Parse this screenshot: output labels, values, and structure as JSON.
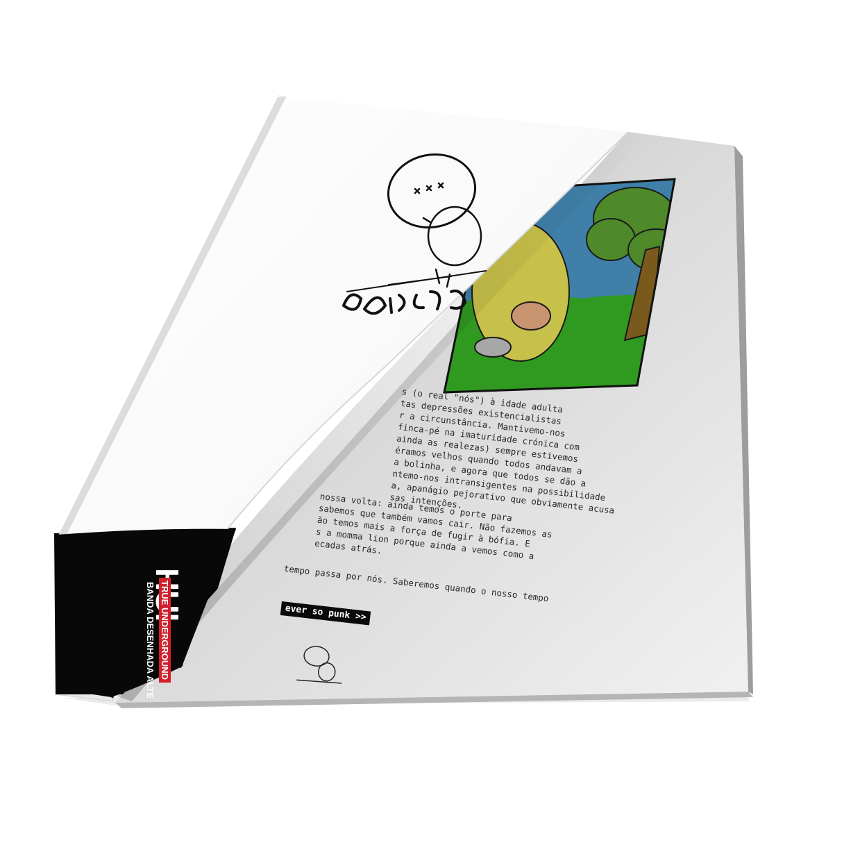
{
  "paragraphs": [
    {
      "lines": [
        "s (o real \"nós\") à idade adulta",
        "tas depressões existencialistas",
        "r a circunstância. Mantivemo-nos",
        "finca-pé na imaturidade crónica com",
        "ainda as realezas) sempre estivemos",
        "éramos velhos quando todos andavam a",
        "a bolinha, e agora que todos se dão a",
        "ntemo-nos intransigentes na possibilidade",
        "a, apanágio pejorativo que obviamente acusa",
        "sas intenções."
      ]
    },
    {
      "lines": [
        "nossa volta: ainda temos o porte para",
        "sabemos que também vamos cair. Não fazemos as",
        "ão temos mais a força de fugir à bófia. E",
        "s a momma lion porque ainda a vemos como a",
        "ecadas atrás."
      ]
    },
    {
      "lines": [
        "tempo passa por nós. Saberemos quando o nosso tempo"
      ]
    }
  ],
  "cta": {
    "label": "ever so punk >>"
  },
  "cover": {
    "title": "HUI",
    "tag_primary": "TRUE UNDERGROUND",
    "tag_secondary": "BANDA DESENHADA ALTE"
  },
  "logo": {
    "mark": "xxx"
  },
  "colors": {
    "page_white": "#ffffff",
    "page_gray": "#c9c9c9",
    "cover_black": "#080808",
    "tag_red": "#d21f2a",
    "sky_blue": "#3f7fa8",
    "grass_green": "#2f9a1f",
    "tree_green": "#4e8a2a"
  }
}
